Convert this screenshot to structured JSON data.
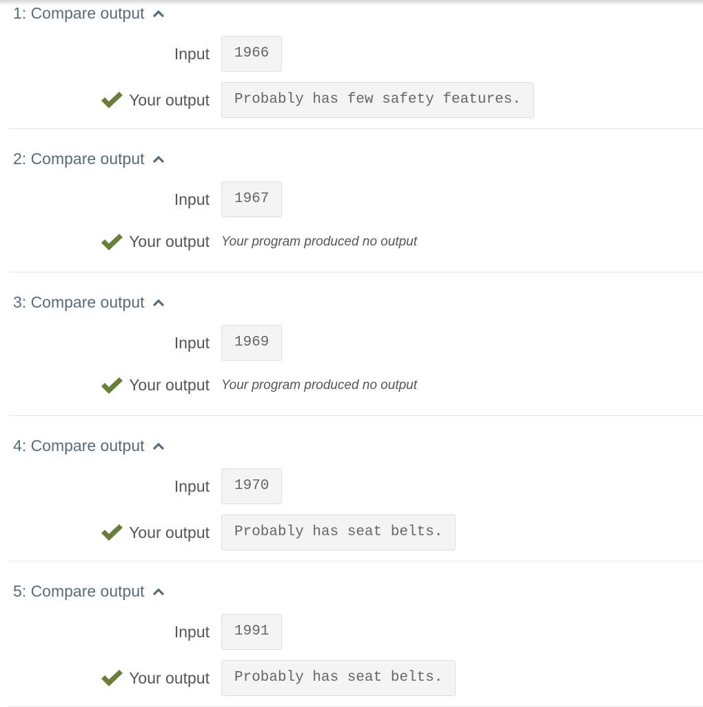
{
  "tests": [
    {
      "heading": "1: Compare output",
      "input_label": "Input",
      "input": "1966",
      "output_label": "Your output",
      "output": "Probably has few safety features.",
      "status": "pass"
    },
    {
      "heading": "2: Compare output",
      "input_label": "Input",
      "input": "1967",
      "output_label": "Your output",
      "output": "Your program produced no output",
      "no_output": true,
      "status": "pass"
    },
    {
      "heading": "3: Compare output",
      "input_label": "Input",
      "input": "1969",
      "output_label": "Your output",
      "output": "Your program produced no output",
      "no_output": true,
      "status": "pass"
    },
    {
      "heading": "4: Compare output",
      "input_label": "Input",
      "input": "1970",
      "output_label": "Your output",
      "output": "Probably has seat belts.",
      "status": "pass"
    },
    {
      "heading": "5: Compare output",
      "input_label": "Input",
      "input": "1991",
      "output_label": "Your output",
      "output": "Probably has seat belts.",
      "status": "pass"
    }
  ],
  "colors": {
    "check": "#6b7d3a",
    "heading": "#5a6b78"
  },
  "icons": {
    "toggle": "chevron-up-icon",
    "status": "checkmark-icon"
  }
}
